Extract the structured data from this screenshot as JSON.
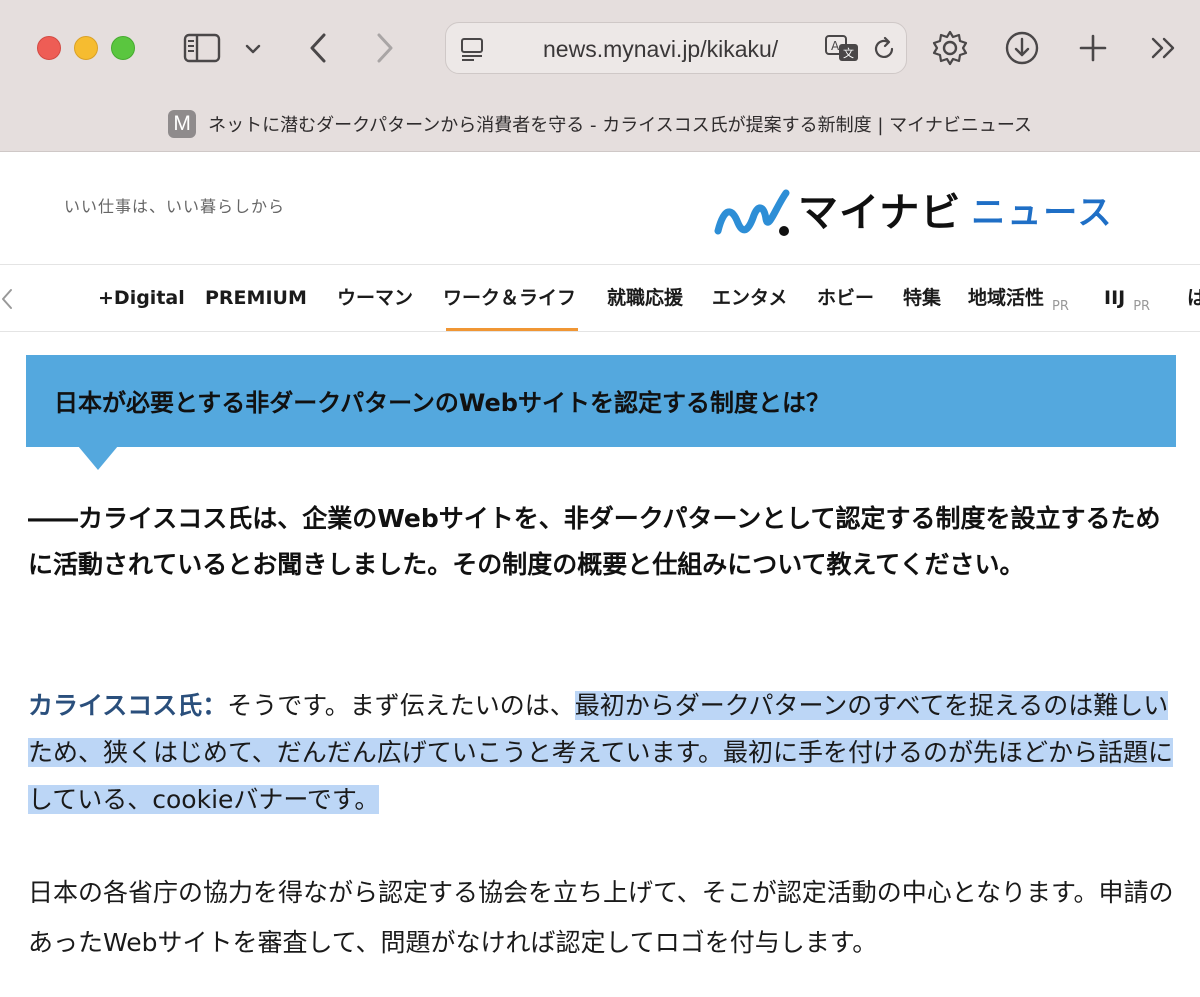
{
  "browser": {
    "url": "news.mynavi.jp/kikaku/",
    "tab": {
      "favicon_letter": "M",
      "title": "ネットに潜むダークパターンから消費者を守る - カライスコス氏が提案する新制度 | マイナビニュース"
    }
  },
  "site": {
    "tagline": "いい仕事は、いい暮らしから",
    "logo_main": "マイナビ",
    "logo_sub": "ニュース",
    "accent_color": "#f09634",
    "brand_color": "#1f6fc6"
  },
  "nav": {
    "items": [
      {
        "label": "+Digital"
      },
      {
        "label": "PREMIUM"
      },
      {
        "label": "ウーマン"
      },
      {
        "label": "ワーク＆ライフ",
        "active": true
      },
      {
        "label": "就職応援"
      },
      {
        "label": "エンタメ"
      },
      {
        "label": "ホビー"
      },
      {
        "label": "特集"
      },
      {
        "label": "地域活性",
        "badge": "PR"
      },
      {
        "label": "IIJ",
        "badge": "PR"
      },
      {
        "label": "は"
      }
    ]
  },
  "article": {
    "section_heading": "日本が必要とする非ダークパターンのWebサイトを認定する制度とは？",
    "heading_color": "#54a8de",
    "question": "――カライスコス氏は、企業のWebサイトを、非ダークパターンとして認定する制度を設立するために活動されているとお聞きしました。その制度の概要と仕組みについて教えてください。",
    "answer": {
      "speaker": "カライスコス氏：",
      "text_plain": "そうです。まず伝えたいのは、",
      "text_highlighted": "最初からダークパターンのすべてを捉えるのは難しいため、狭くはじめて、だんだん広げていこうと考えています。最初に手を付けるのが先ほどから話題にしている、cookieバナーです。"
    },
    "paragraph2": "日本の各省庁の協力を得ながら認定する協会を立ち上げて、そこが認定活動の中心となります。申請のあったWebサイトを審査して、問題がなければ認定してロゴを付与します。"
  }
}
